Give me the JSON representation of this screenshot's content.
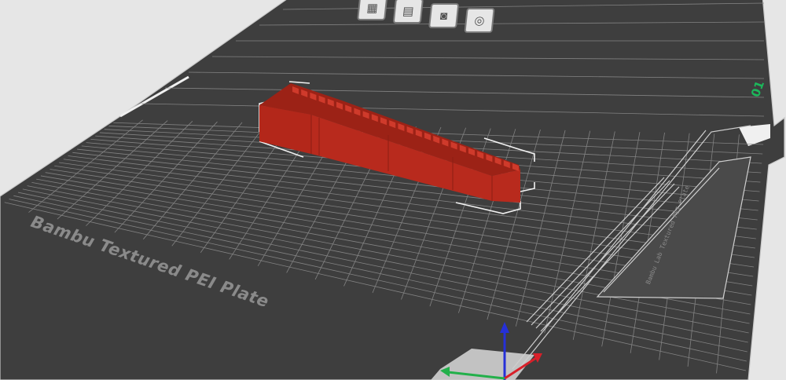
{
  "plate": {
    "name": "Bambu Textured PEI Plate",
    "number": "01",
    "side_text": "Bambu Lab Textured PEI Plate",
    "background_color": "#3c3c3c",
    "grid_color": "#8a8a8a",
    "edge_color": "#e8e8e8"
  },
  "plate_toolbar": {
    "icons": [
      "arrange-icon",
      "layout-icon",
      "lock-icon",
      "settings-icon"
    ]
  },
  "model": {
    "name": "red model",
    "color": "#b2281c",
    "selected": true
  },
  "axes": {
    "x_color": "#d8202a",
    "y_color": "#22b04a",
    "z_color": "#2530d8"
  }
}
